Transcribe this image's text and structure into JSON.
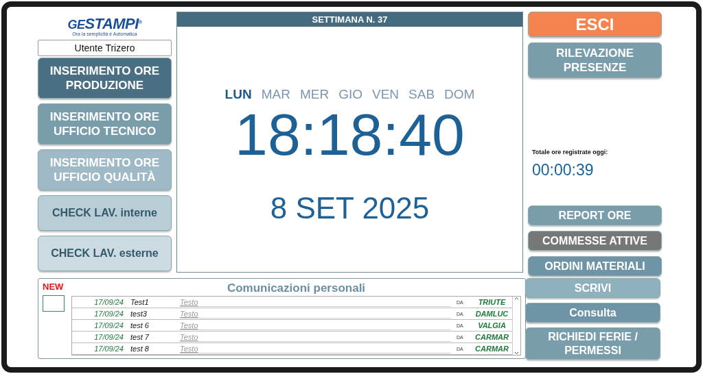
{
  "logo": {
    "brand_left": "GE",
    "brand_right": "STAMPI",
    "registered": "®",
    "tagline": "Ora la semplicità è Automatica"
  },
  "user": {
    "value": "Utente Trizero"
  },
  "left_buttons": [
    {
      "label": "INSERIMENTO ORE PRODUZIONE",
      "color": "#4a6f82"
    },
    {
      "label": "INSERIMENTO ORE UFFICIO TECNICO",
      "color": "#7a9dac"
    },
    {
      "label": "INSERIMENTO ORE UFFICIO QUALITÀ",
      "color": "#9fbac6"
    },
    {
      "label": "CHECK LAV. interne",
      "color": "#b8cdd6"
    },
    {
      "label": "CHECK LAV. esterne",
      "color": "#cbdbe1"
    }
  ],
  "week": {
    "title": "SETTIMANA N. 37"
  },
  "days": [
    {
      "label": "LUN",
      "selected": true
    },
    {
      "label": "MAR",
      "selected": false
    },
    {
      "label": "MER",
      "selected": false
    },
    {
      "label": "GIO",
      "selected": false
    },
    {
      "label": "VEN",
      "selected": false
    },
    {
      "label": "SAB",
      "selected": false
    },
    {
      "label": "DOM",
      "selected": false
    }
  ],
  "clock": "18:18:40",
  "date": "8 SET 2025",
  "top_right_buttons": [
    {
      "label": "ESCI",
      "color": "#f5834e"
    },
    {
      "label": "RILEVAZIONE PRESENZE",
      "color": "#7a9dac"
    }
  ],
  "total": {
    "label": "Totale ore registrate oggi:",
    "value": "00:00:39"
  },
  "right_buttons": [
    {
      "label": "REPORT ORE",
      "color": "#7a9dac"
    },
    {
      "label": "COMMESSE ATTIVE",
      "color": "#777777"
    },
    {
      "label": "ORDINI MATERIALI",
      "color": "#6f94a6"
    }
  ],
  "messages": {
    "new_label": "NEW",
    "new_checked": false,
    "title": "Comunicazioni personali",
    "rows": [
      {
        "date": "17/09/24",
        "subject": "Test1",
        "text": "Testo",
        "da": "DA",
        "author": "TRIUTE"
      },
      {
        "date": "17/09/24",
        "subject": "test3",
        "text": "Testo",
        "da": "DA",
        "author": "DAMLUC"
      },
      {
        "date": "17/09/24",
        "subject": "test 6",
        "text": "Testo",
        "da": "DA",
        "author": "VALGIA"
      },
      {
        "date": "17/09/24",
        "subject": "test 7",
        "text": "Testo",
        "da": "DA",
        "author": "CARMAR"
      },
      {
        "date": "17/09/24",
        "subject": "test 8",
        "text": "Testo",
        "da": "DA",
        "author": "CARMAR"
      }
    ]
  },
  "bottom_buttons": [
    {
      "label": "SCRIVI",
      "color": "#8fb1be"
    },
    {
      "label": "Consulta",
      "color": "#6f94a6"
    },
    {
      "label": "RICHIEDI FERIE / PERMESSI",
      "color": "#7a9dac"
    }
  ]
}
